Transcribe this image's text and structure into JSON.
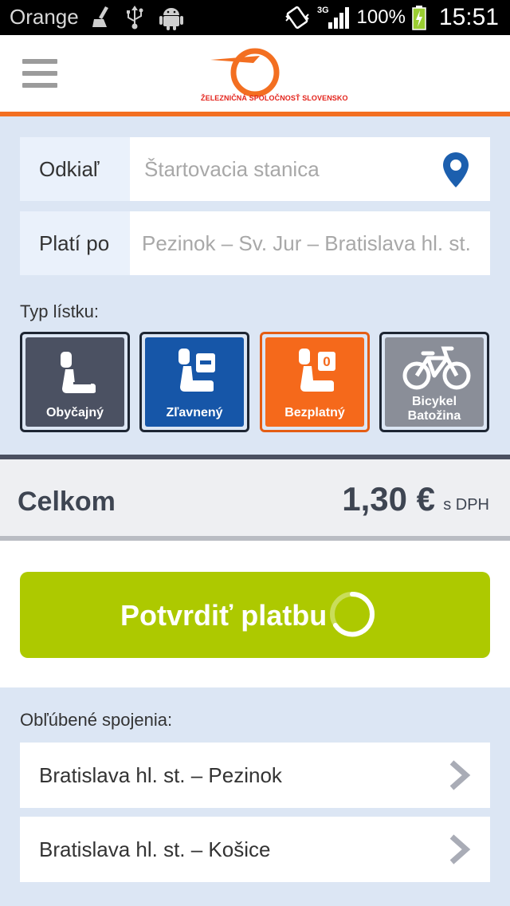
{
  "status_bar": {
    "carrier": "Orange",
    "network": "3G",
    "battery": "100%",
    "time": "15:51"
  },
  "header": {
    "logo_text": "ŽELEZNIČNÁ SPOLOČNOSŤ SLOVENSKO"
  },
  "form": {
    "from": {
      "label": "Odkiaľ",
      "placeholder": "Štartovacia stanica",
      "value": ""
    },
    "valid_to": {
      "label": "Platí po",
      "value": "Pezinok – Sv. Jur – Bratislava hl. st."
    },
    "ticket_type_label": "Typ lístku:",
    "ticket_types": [
      {
        "caption": "Obyčajný",
        "color": "#4b5162",
        "icon": "seat-icon"
      },
      {
        "caption": "Zľavnený",
        "color": "#1656a8",
        "icon": "seat-minus-icon"
      },
      {
        "caption": "Bezplatný",
        "color": "#f5691b",
        "icon": "seat-zero-icon",
        "badge": "0"
      },
      {
        "caption_line1": "Bicykel",
        "caption_line2": "Batožina",
        "color": "#8a8e98",
        "icon": "bicycle-icon"
      }
    ]
  },
  "total": {
    "label": "Celkom",
    "amount": "1,30 €",
    "suffix": "s DPH"
  },
  "pay": {
    "label": "Potvrdiť platbu"
  },
  "favourites": {
    "title": "Obľúbené spojenia:",
    "items": [
      {
        "label": "Bratislava hl. st. – Pezinok"
      },
      {
        "label": "Bratislava hl. st. – Košice"
      }
    ]
  },
  "colors": {
    "accent_orange": "#f36f21",
    "confirm_green": "#adc900",
    "panel_blue": "#dce6f4",
    "pin_blue": "#1c5fae"
  }
}
